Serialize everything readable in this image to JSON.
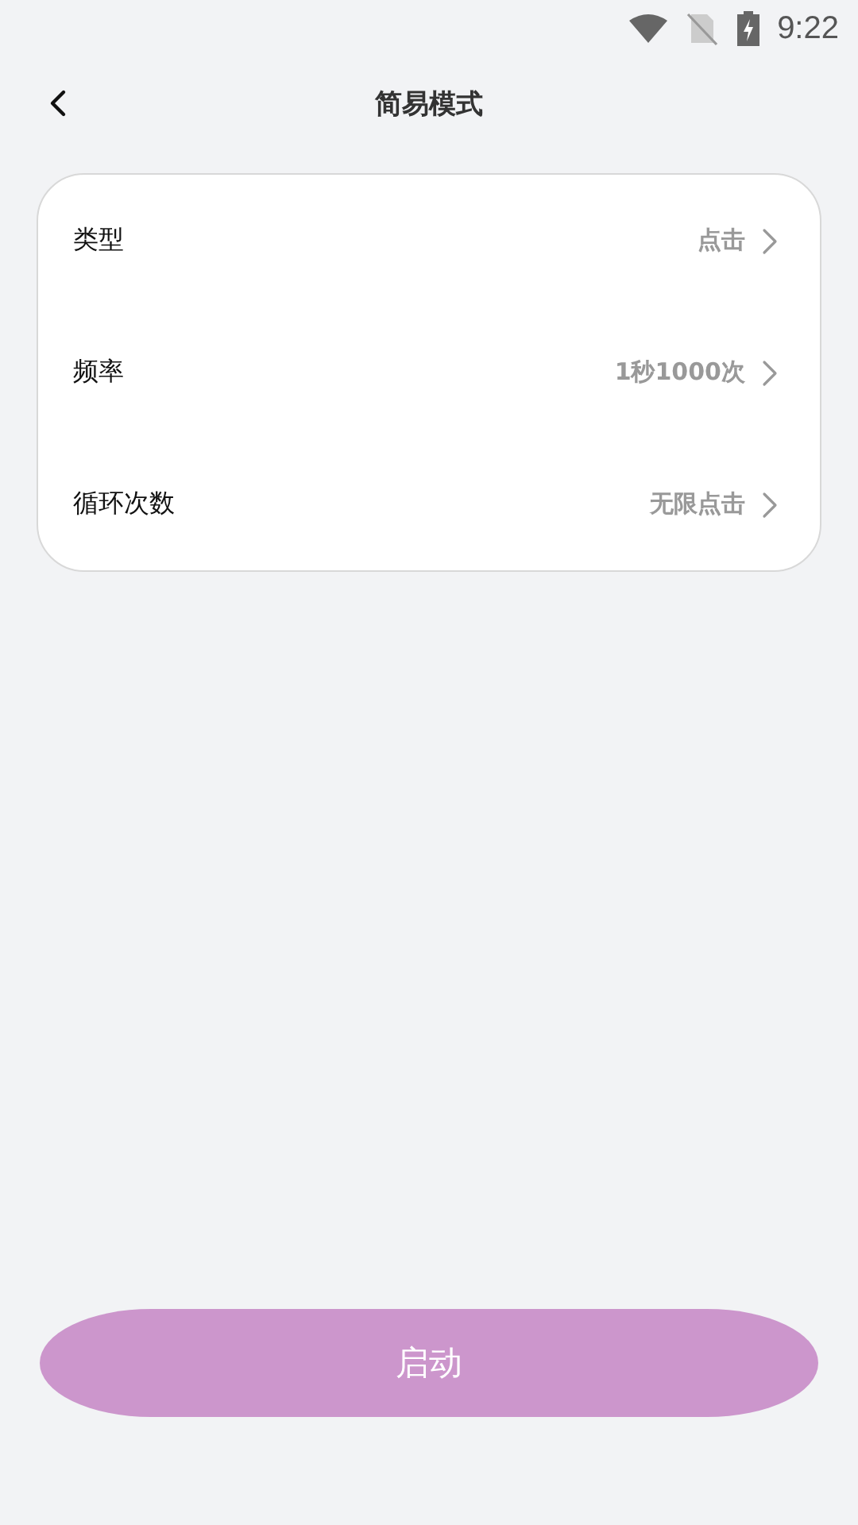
{
  "status_bar": {
    "time": "9:22"
  },
  "header": {
    "title": "简易模式"
  },
  "settings": [
    {
      "label": "类型",
      "value": "点击"
    },
    {
      "label": "频率",
      "value": "1秒1000次"
    },
    {
      "label": "循环次数",
      "value": "无限点击"
    }
  ],
  "start_button": {
    "label": "启动"
  }
}
